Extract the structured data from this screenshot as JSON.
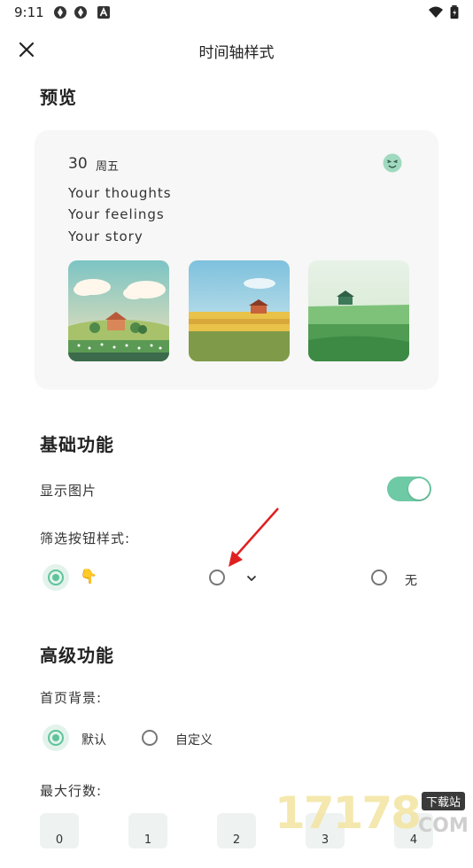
{
  "status_bar": {
    "time": "9:11",
    "left_icons": [
      "sync-icon",
      "sync-icon",
      "a-icon"
    ],
    "right_icons": [
      "wifi-icon",
      "battery-icon"
    ]
  },
  "header": {
    "title": "时间轴样式",
    "close_icon": "close-icon"
  },
  "preview": {
    "heading": "预览",
    "date_number": "30",
    "weekday": "周五",
    "mood_icon": "mood-face-icon",
    "lines": [
      "Your thoughts",
      "Your feelings",
      "Your story"
    ],
    "images": [
      "cottage-landscape-image",
      "farm-wheat-field-image",
      "green-meadow-image"
    ]
  },
  "basic": {
    "heading": "基础功能",
    "show_image_label": "显示图片",
    "show_image_on": true,
    "filter_style_label": "筛选按钮样式:",
    "filter_options": [
      {
        "glyph": "👇",
        "selected": true
      },
      {
        "glyph": "⌄",
        "selected": false
      },
      {
        "text": "无",
        "selected": false
      }
    ]
  },
  "advanced": {
    "heading": "高级功能",
    "home_bg_label": "首页背景:",
    "home_bg_options": [
      {
        "text": "默认",
        "selected": true
      },
      {
        "text": "自定义",
        "selected": false
      }
    ],
    "max_rows_label": "最大行数:",
    "max_rows_options": [
      "0",
      "1",
      "2",
      "3",
      "4"
    ]
  },
  "watermark": {
    "text": "17178",
    "badge": "下载站",
    "suffix": "COM"
  },
  "colors": {
    "accent": "#5fc39b",
    "card_bg": "#f6f7f6",
    "annotation_arrow": "#e02020"
  }
}
